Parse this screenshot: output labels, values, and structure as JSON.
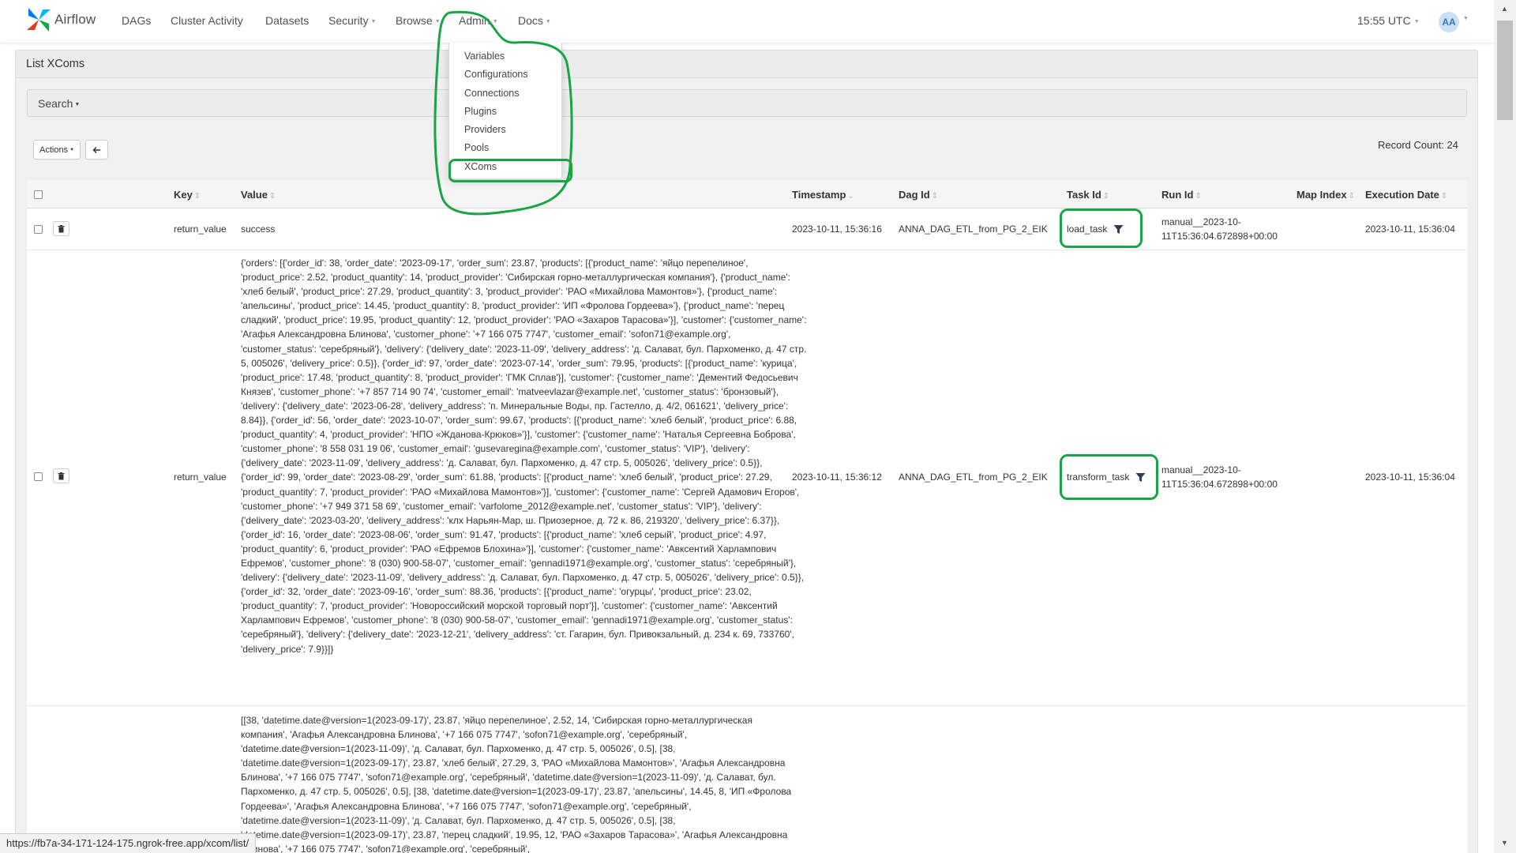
{
  "navbar": {
    "brand": "Airflow",
    "items": [
      {
        "label": "DAGs",
        "has_caret": false
      },
      {
        "label": "Cluster Activity",
        "has_caret": false
      },
      {
        "label": "Datasets",
        "has_caret": false
      },
      {
        "label": "Security",
        "has_caret": true
      },
      {
        "label": "Browse",
        "has_caret": true
      },
      {
        "label": "Admin",
        "has_caret": true
      },
      {
        "label": "Docs",
        "has_caret": true
      }
    ],
    "time": "15:55 UTC",
    "user_initials": "AA"
  },
  "admin_menu": {
    "items": [
      "Variables",
      "Configurations",
      "Connections",
      "Plugins",
      "Providers",
      "Pools",
      "XComs"
    ]
  },
  "page": {
    "title": "List XComs",
    "search_label": "Search",
    "actions_label": "Actions",
    "back_icon": "arrow-left-icon",
    "record_count_label": "Record Count:",
    "record_count": "24"
  },
  "table": {
    "columns": [
      "Key",
      "Value",
      "Timestamp",
      "Dag Id",
      "Task Id",
      "Run Id",
      "Map Index",
      "Execution Date"
    ],
    "rows": [
      {
        "key": "return_value",
        "value": "success",
        "timestamp": "2023-10-11, 15:36:16",
        "dag_id": "ANNA_DAG_ETL_from_PG_2_EIK",
        "task_id": "load_task",
        "run_id_line1": "manual__2023-10-",
        "run_id_line2": "11T15:36:04.672898+00:00",
        "map_index": "",
        "execution_date": "2023-10-11, 15:36:04"
      },
      {
        "key": "return_value",
        "value": "{'orders': [{'order_id': 38, 'order_date': '2023-09-17', 'order_sum': 23.87, 'products': [{'product_name': 'яйцо перепелиное', 'product_price': 2.52, 'product_quantity': 14, 'product_provider': 'Сибирская горно-металлургическая компания'}, {'product_name': 'хлеб белый', 'product_price': 27.29, 'product_quantity': 3, 'product_provider': 'РАО «Михайлова Мамонтов»'}, {'product_name': 'апельсины', 'product_price': 14.45, 'product_quantity': 8, 'product_provider': 'ИП «Фролова Гордеева»'}, {'product_name': 'перец сладкий', 'product_price': 19.95, 'product_quantity': 12, 'product_provider': 'РАО «Захаров Тарасова»'}], 'customer': {'customer_name': 'Агафья Александровна Блинова', 'customer_phone': '+7 166 075 7747', 'customer_email': 'sofon71@example.org', 'customer_status': 'серебряный'}, 'delivery': {'delivery_date': '2023-11-09', 'delivery_address': 'д. Салават, бул. Пархоменко, д. 47 стр. 5, 005026', 'delivery_price': 0.5}}, {'order_id': 97, 'order_date': '2023-07-14', 'order_sum': 79.95, 'products': [{'product_name': 'курица', 'product_price': 17.48, 'product_quantity': 8, 'product_provider': 'ГМК Сплав'}], 'customer': {'customer_name': 'Дементий Федосьевич Князев', 'customer_phone': '+7 857 714 90 74', 'customer_email': 'matveevlazar@example.net', 'customer_status': 'бронзовый'}, 'delivery': {'delivery_date': '2023-06-28', 'delivery_address': 'п. Минеральные Воды, пр. Гастелло, д. 4/2, 061621', 'delivery_price': 8.84}}, {'order_id': 56, 'order_date': '2023-10-07', 'order_sum': 99.67, 'products': [{'product_name': 'хлеб белый', 'product_price': 6.88, 'product_quantity': 4, 'product_provider': 'НПО «Жданова-Крюков»'}], 'customer': {'customer_name': 'Наталья Сергеевна Боброва', 'customer_phone': '8 558 031 19 06', 'customer_email': 'gusevaregina@example.com', 'customer_status': 'VIP'}, 'delivery': {'delivery_date': '2023-11-09', 'delivery_address': 'д. Салават, бул. Пархоменко, д. 47 стр. 5, 005026', 'delivery_price': 0.5}}, {'order_id': 99, 'order_date': '2023-08-29', 'order_sum': 61.88, 'products': [{'product_name': 'хлеб белый', 'product_price': 27.29, 'product_quantity': 7, 'product_provider': 'РАО «Михайлова Мамонтов»'}], 'customer': {'customer_name': 'Сергей Адамович Егоров', 'customer_phone': '+7 949 371 58 69', 'customer_email': 'varfolome_2012@example.net', 'customer_status': 'VIP'}, 'delivery': {'delivery_date': '2023-03-20', 'delivery_address': 'клх Нарьян-Мар, ш. Приозерное, д. 72 к. 86, 219320', 'delivery_price': 6.37}}, {'order_id': 16, 'order_date': '2023-08-06', 'order_sum': 91.47, 'products': [{'product_name': 'хлеб серый', 'product_price': 4.97, 'product_quantity': 6, 'product_provider': 'РАО «Ефремов Блохина»'}], 'customer': {'customer_name': 'Авксентий Харлампович Ефремов', 'customer_phone': '8 (030) 900-58-07', 'customer_email': 'gennadi1971@example.org', 'customer_status': 'серебряный'}, 'delivery': {'delivery_date': '2023-11-09', 'delivery_address': 'д. Салават, бул. Пархоменко, д. 47 стр. 5, 005026', 'delivery_price': 0.5}}, {'order_id': 32, 'order_date': '2023-09-16', 'order_sum': 88.36, 'products': [{'product_name': 'огурцы', 'product_price': 23.02, 'product_quantity': 7, 'product_provider': 'Новороссийский морской торговый порт'}], 'customer': {'customer_name': 'Авксентий Харлампович Ефремов', 'customer_phone': '8 (030) 900-58-07', 'customer_email': 'gennadi1971@example.org', 'customer_status': 'серебряный'}, 'delivery': {'delivery_date': '2023-12-21', 'delivery_address': 'ст. Гагарин, бул. Привокзальный, д. 234 к. 69, 733760', 'delivery_price': 7.9}}]}",
        "timestamp": "2023-10-11, 15:36:12",
        "dag_id": "ANNA_DAG_ETL_from_PG_2_EIK",
        "task_id": "transform_task",
        "run_id_line1": "manual__2023-10-",
        "run_id_line2": "11T15:36:04.672898+00:00",
        "map_index": "",
        "execution_date": "2023-10-11, 15:36:04"
      },
      {
        "key": "",
        "value": "[[38, 'datetime.date@version=1(2023-09-17)', 23.87, 'яйцо перепелиное', 2.52, 14, 'Сибирская горно-металлургическая компания', 'Агафья Александровна Блинова', '+7 166 075 7747', 'sofon71@example.org', 'серебряный', 'datetime.date@version=1(2023-11-09)', 'д. Салават, бул. Пархоменко, д. 47 стр. 5, 005026', 0.5], [38, 'datetime.date@version=1(2023-09-17)', 23.87, 'хлеб белый', 27.29, 3, 'РАО «Михайлова Мамонтов»', 'Агафья Александровна Блинова', '+7 166 075 7747', 'sofon71@example.org', 'серебряный', 'datetime.date@version=1(2023-11-09)', 'д. Салават, бул. Пархоменко, д. 47 стр. 5, 005026', 0.5], [38, 'datetime.date@version=1(2023-09-17)', 23.87, 'апельсины', 14.45, 8, 'ИП «Фролова Гордеева»', 'Агафья Александровна Блинова', '+7 166 075 7747', 'sofon71@example.org', 'серебряный', 'datetime.date@version=1(2023-11-09)', 'д. Салават, бул. Пархоменко, д. 47 стр. 5, 005026', 0.5], [38, 'datetime.date@version=1(2023-09-17)', 23.87, 'перец сладкий', 19.95, 12, 'РАО «Захаров Тарасова»', 'Агафья Александровна Блинова', '+7 166 075 7747', 'sofon71@example.org', 'серебряный',"
      }
    ]
  },
  "status_url": "https://fb7a-34-171-124-175.ngrok-free.app/xcom/list/",
  "colors": {
    "annotation": "#19a545",
    "avatar_bg": "#cbe0f6",
    "avatar_text": "#3379b7",
    "panel_bg": "#f0f0f0",
    "header_bg": "#ececec",
    "filter_icon": "#2f3c56"
  }
}
